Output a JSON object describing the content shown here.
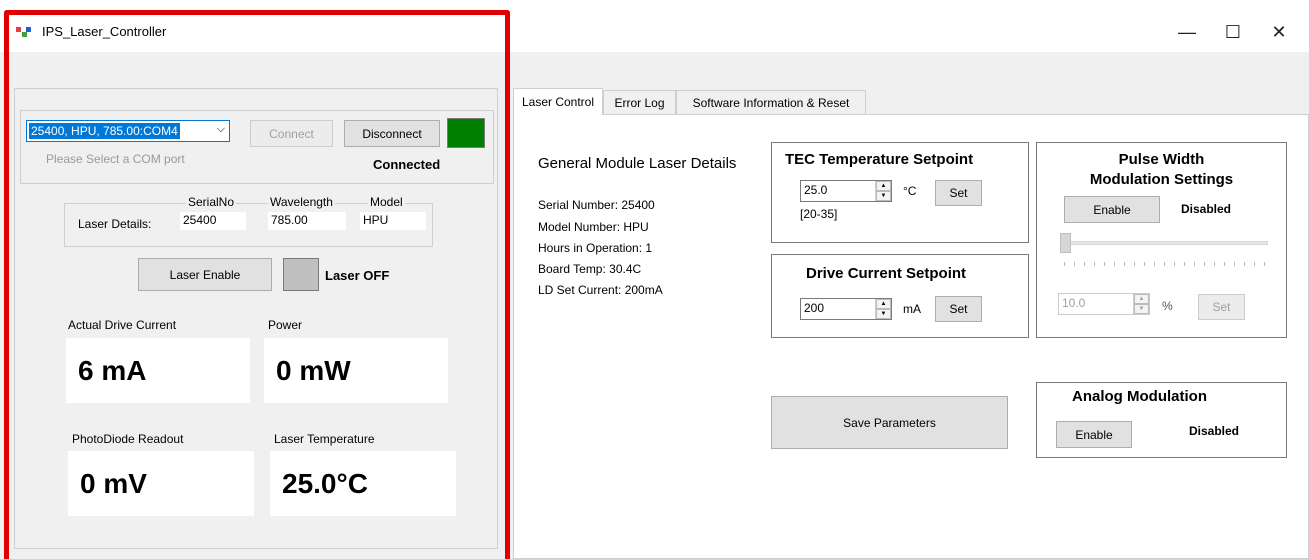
{
  "window": {
    "title": "IPS_Laser_Controller",
    "minimize": "—",
    "maximize": "☐",
    "close": "✕"
  },
  "connection": {
    "com_selected": "25400, HPU, 785.00:COM4",
    "com_hint": "Please Select a COM port",
    "connect_label": "Connect",
    "disconnect_label": "Disconnect",
    "status": "Connected",
    "indicator_color": "#008000"
  },
  "laser_details": {
    "label": "Laser Details:",
    "serial_header": "SerialNo",
    "serial": "25400",
    "wavelength_header": "Wavelength",
    "wavelength": "785.00",
    "model_header": "Model",
    "model": "HPU"
  },
  "enable": {
    "button_label": "Laser Enable",
    "status": "Laser OFF",
    "indicator_color": "#c0c0c0"
  },
  "readouts": {
    "drive_current_label": "Actual Drive Current",
    "drive_current": "6 mA",
    "power_label": "Power",
    "power": "0 mW",
    "photodiode_label": "PhotoDiode Readout",
    "photodiode": "0 mV",
    "temperature_label": "Laser Temperature",
    "temperature": "25.0°C"
  },
  "tabs": [
    {
      "label": "Laser Control"
    },
    {
      "label": "Error Log"
    },
    {
      "label": "Software Information & Reset"
    }
  ],
  "general": {
    "title": "General Module Laser Details",
    "serial": "Serial Number:  25400",
    "model": "Model Number:  HPU",
    "hours": "Hours in Operation: 1",
    "board_temp": "Board Temp: 30.4C",
    "ld_current": "LD Set Current: 200mA"
  },
  "tec": {
    "title": "TEC Temperature Setpoint",
    "value": "25.0",
    "unit": "°C",
    "set_label": "Set",
    "range": "[20-35]"
  },
  "drive": {
    "title": "Drive Current Setpoint",
    "value": "200",
    "unit": "mA",
    "set_label": "Set"
  },
  "pwm": {
    "title_line1": "Pulse Width",
    "title_line2": "Modulation Settings",
    "enable_label": "Enable",
    "status": "Disabled",
    "value": "10.0",
    "unit": "%",
    "set_label": "Set",
    "slider_level": 0
  },
  "save_label": "Save Parameters",
  "analog": {
    "title": "Analog Modulation",
    "enable_label": "Enable",
    "status": "Disabled"
  },
  "highlight_color": "#e00000"
}
